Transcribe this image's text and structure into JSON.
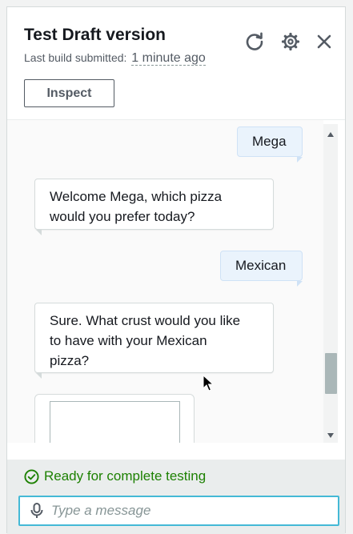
{
  "header": {
    "title": "Test Draft version",
    "subtitle_prefix": "Last build submitted:",
    "subtitle_time": "1 minute ago",
    "icons": [
      "refresh-icon",
      "settings-icon",
      "close-icon"
    ],
    "inspect_label": "Inspect"
  },
  "conversation": [
    {
      "role": "user",
      "text": "Mega"
    },
    {
      "role": "bot",
      "lines": [
        "Welcome Mega, which pizza",
        "would you prefer today?"
      ]
    },
    {
      "role": "user",
      "text": "Mexican"
    },
    {
      "role": "bot",
      "lines": [
        "Sure. What crust would you like",
        "to have with your Mexican",
        "pizza?"
      ]
    }
  ],
  "footer": {
    "status_text": "Ready for complete testing",
    "input_placeholder": "Type a message"
  },
  "colors": {
    "accent": "#44b9d6",
    "success": "#1d8102",
    "user_bubble": "#eaf3fc"
  }
}
